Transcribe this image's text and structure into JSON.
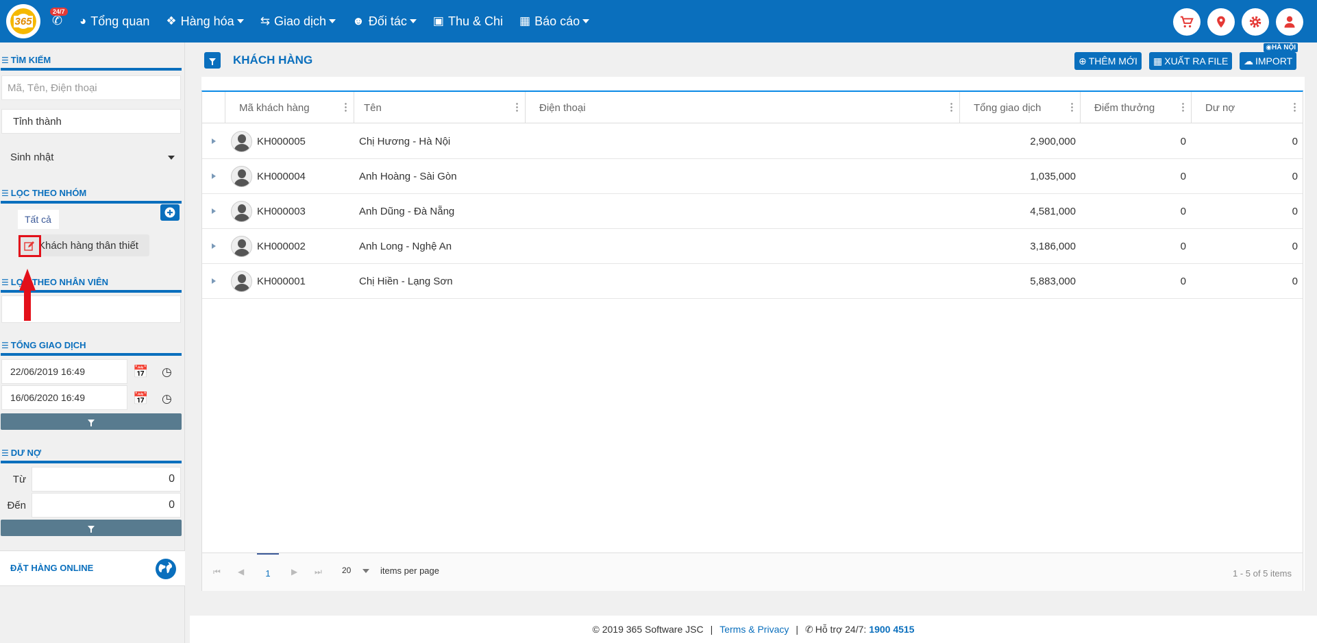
{
  "nav": {
    "logo_text": "365",
    "badge": "24/7",
    "items": [
      {
        "label": "Tổng quan",
        "icon": "dashboard-icon",
        "caret": false
      },
      {
        "label": "Hàng hóa",
        "icon": "cubes-icon",
        "caret": true
      },
      {
        "label": "Giao dịch",
        "icon": "exchange-icon",
        "caret": true
      },
      {
        "label": "Đối tác",
        "icon": "users-icon",
        "caret": true
      },
      {
        "label": "Thu & Chi",
        "icon": "money-icon",
        "caret": false
      },
      {
        "label": "Báo cáo",
        "icon": "bar-chart-icon",
        "caret": true
      }
    ],
    "right_buttons": [
      "cart-icon",
      "location-icon",
      "gear-icon",
      "user-icon"
    ]
  },
  "sidebar": {
    "search": {
      "title": "TÌM KIẾM",
      "placeholder": "Mã, Tên, Điện thoại",
      "province": "Tỉnh thành",
      "birthday": "Sinh nhật"
    },
    "group": {
      "title": "LỌC THEO NHÓM",
      "all": "Tất cả",
      "item": "Khách hàng thân thiết"
    },
    "staff": {
      "title": "LỌC THEO NHÂN VIÊN"
    },
    "transaction": {
      "title": "TỔNG GIAO DỊCH",
      "from": "22/06/2019 16:49",
      "to": "16/06/2020 16:49"
    },
    "debt": {
      "title": "DƯ NỢ",
      "from_label": "Từ",
      "from_value": "0",
      "to_label": "Đến",
      "to_value": "0"
    },
    "online": {
      "label": "ĐẶT HÀNG ONLINE"
    }
  },
  "main": {
    "title": "KHÁCH HÀNG",
    "location": "HÀ NỘI",
    "buttons": {
      "add": "THÊM MỚI",
      "export": "XUẤT RA FILE",
      "import": "IMPORT"
    },
    "columns": [
      "Mã khách hàng",
      "Tên",
      "Điện thoại",
      "Tổng giao dịch",
      "Điểm thưởng",
      "Dư nợ"
    ],
    "rows": [
      {
        "code": "KH000005",
        "name": "Chị Hương - Hà Nội",
        "phone": "",
        "total": "2,900,000",
        "points": "0",
        "debt": "0"
      },
      {
        "code": "KH000004",
        "name": "Anh Hoàng - Sài Gòn",
        "phone": "",
        "total": "1,035,000",
        "points": "0",
        "debt": "0"
      },
      {
        "code": "KH000003",
        "name": "Anh Dũng - Đà Nẵng",
        "phone": "",
        "total": "4,581,000",
        "points": "0",
        "debt": "0"
      },
      {
        "code": "KH000002",
        "name": "Anh Long - Nghệ An",
        "phone": "",
        "total": "3,186,000",
        "points": "0",
        "debt": "0"
      },
      {
        "code": "KH000001",
        "name": "Chị Hiền - Lạng Sơn",
        "phone": "",
        "total": "5,883,000",
        "points": "0",
        "debt": "0"
      }
    ],
    "pager": {
      "page": "1",
      "page_size": "20",
      "items_label": "items per page",
      "info": "1 - 5 of 5 items"
    }
  },
  "footer": {
    "copyright": "© 2019 365 Software JSC",
    "terms": "Terms & Privacy",
    "support_label": "Hỗ trợ 24/7:",
    "support_phone": "1900 4515"
  }
}
